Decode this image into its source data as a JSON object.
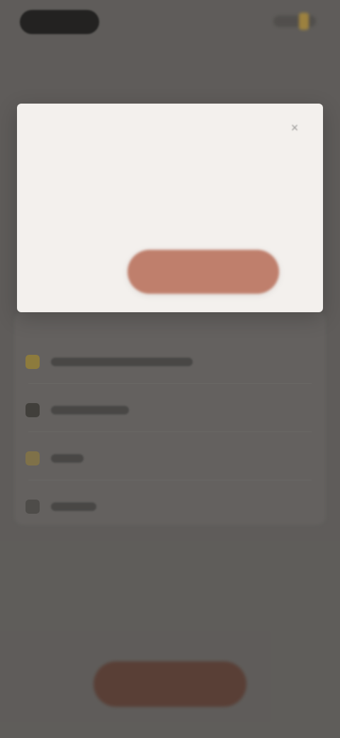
{
  "status_bar": {
    "time": "",
    "icons": [
      "status-pill",
      "signal-icon",
      "battery-icon"
    ]
  },
  "modal": {
    "title": "",
    "body": "",
    "close_icon": "close-icon",
    "secondary_action_label": "",
    "primary_action_label": ""
  },
  "background_list": {
    "items": [
      {
        "label": "",
        "icon": "notification-icon"
      },
      {
        "label": "",
        "icon": "document-icon"
      },
      {
        "label": "",
        "icon": "star-icon"
      },
      {
        "label": "",
        "icon": "settings-icon"
      }
    ]
  },
  "bottom_button": {
    "label": ""
  },
  "colors": {
    "background": "#74716e",
    "modal_background": "#f3f0ed",
    "primary_action": "#bf7f6c",
    "bottom_button": "#6d4c41",
    "status_pill": "#2b2a29",
    "accent_yellow": "#c9a54c"
  }
}
